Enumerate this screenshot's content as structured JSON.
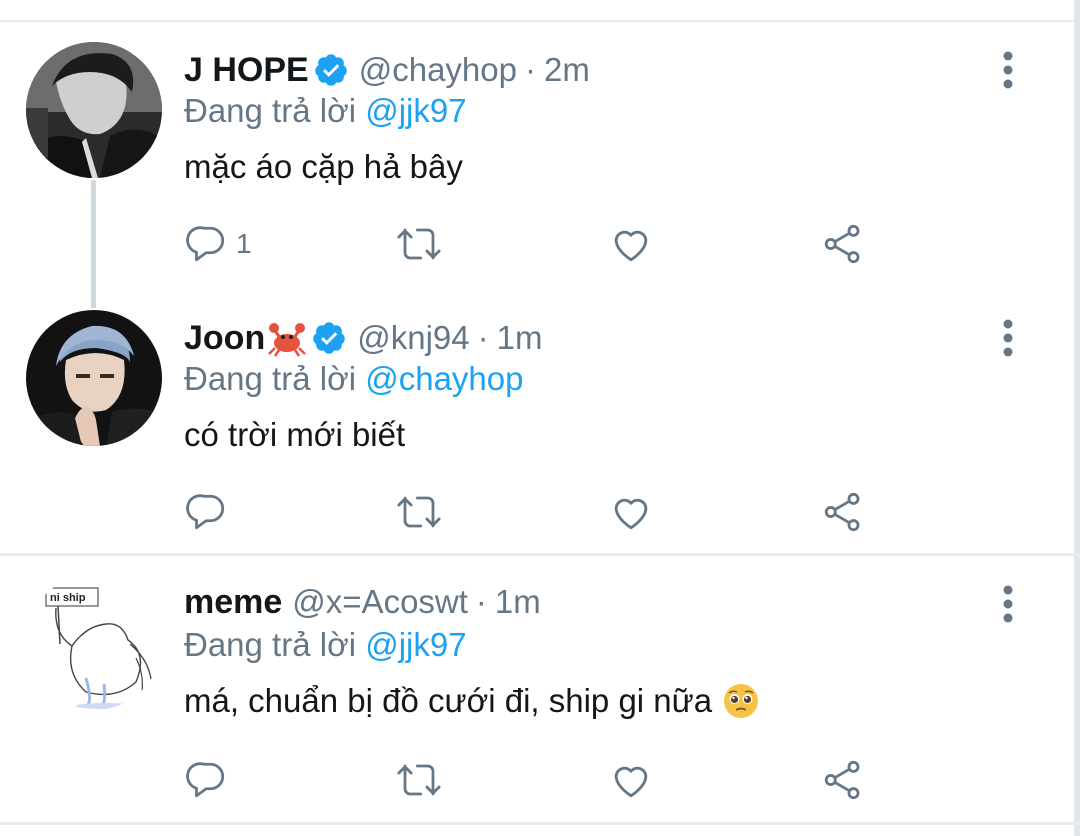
{
  "colors": {
    "accent": "#1da1f2",
    "secondary": "#657786",
    "divider": "#e6ecf0",
    "text": "#14171a"
  },
  "tweets": [
    {
      "name": "J HOPE",
      "handle": "@chayhop",
      "time": "2m",
      "reply_prefix": "Đang trả lời",
      "reply_to": "@jjk97",
      "text": "mặc áo cặp hả bây",
      "reply_count": "1",
      "verified": true
    },
    {
      "name": "Joon",
      "handle": "@knj94",
      "time": "1m",
      "reply_prefix": "Đang trả lời",
      "reply_to": "@chayhop",
      "text": "có trời mới biết",
      "reply_count": "",
      "verified": true
    },
    {
      "name": "meme",
      "handle": "@x=Acoswt",
      "time": "1m",
      "reply_prefix": "Đang trả lời",
      "reply_to": "@jjk97",
      "text": "má, chuẩn bị đồ cưới đi, ship gi nữa",
      "reply_count": "",
      "verified": false,
      "avatar_text": "ni ship"
    }
  ],
  "separator": "·",
  "icons": [
    "reply-icon",
    "retweet-icon",
    "like-icon",
    "share-icon",
    "more-icon",
    "verified-badge-icon",
    "crab-emoji",
    "pleading-face-emoji"
  ]
}
